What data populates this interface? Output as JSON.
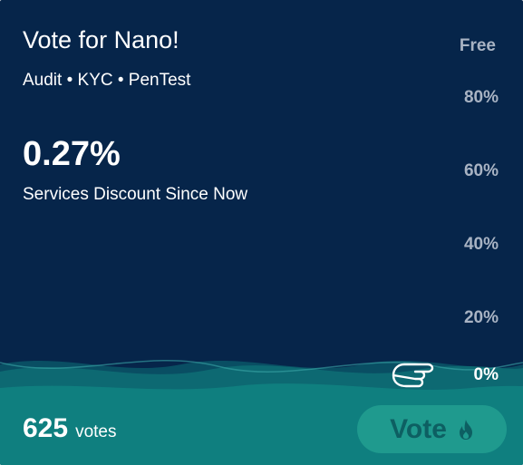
{
  "card": {
    "title": "Vote for Nano!",
    "subtitle": "Audit • KYC • PenTest",
    "discount_value": "0.27%",
    "discount_label": "Services Discount Since Now",
    "progress_fraction": 0.0027
  },
  "scale": {
    "free": "Free",
    "ticks": [
      "80%",
      "60%",
      "40%",
      "20%",
      "0%"
    ]
  },
  "footer": {
    "vote_count": "625",
    "vote_word": "votes",
    "vote_button_label": "Vote"
  },
  "colors": {
    "background": "#06254a",
    "wave_teal": "#0f7f7f",
    "button": "#1f9a8e",
    "button_text": "#0d5f62"
  },
  "icons": {
    "pointer": "pointing-hand-icon",
    "flame": "flame-icon"
  }
}
